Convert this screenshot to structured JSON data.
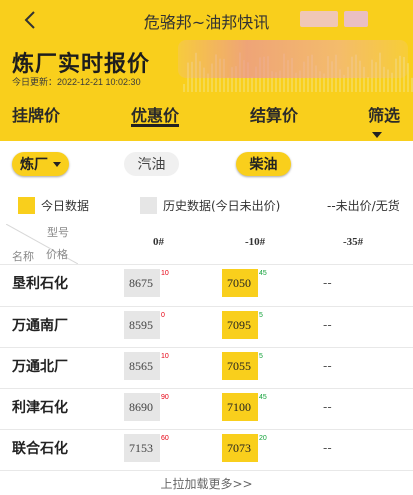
{
  "nav": {
    "title": "危骆邦~油邦快讯"
  },
  "header": {
    "title": "炼厂实时报价",
    "update_time": "今日更新：2022-12-21 10:02:30"
  },
  "tabs": [
    {
      "label": "挂牌价"
    },
    {
      "label": "优惠价",
      "active": true
    },
    {
      "label": "结算价"
    }
  ],
  "filter": {
    "label": "筛选"
  },
  "product_selector": {
    "refinery_dropdown": "炼厂",
    "options": [
      {
        "label": "汽油",
        "selected": false
      },
      {
        "label": "柴油",
        "selected": true
      }
    ]
  },
  "legend": {
    "today": "今日数据",
    "history": "历史数据(今日未出价)",
    "none": "--未出价/无货",
    "today_color": "#f9cf1c",
    "history_color": "#e6e6e6"
  },
  "table": {
    "corner_top": "型号",
    "corner_bottom_left": "名称",
    "corner_bottom_right": "价格",
    "columns": [
      "0#",
      "-10#",
      "-35#"
    ],
    "rows": [
      {
        "name": "垦利石化",
        "c0": "8675",
        "c0_delta": "10",
        "c1": "7050",
        "c1_delta": "45",
        "c2": "--"
      },
      {
        "name": "万通南厂",
        "c0": "8595",
        "c0_delta": "0",
        "c1": "7095",
        "c1_delta": "5",
        "c2": "--"
      },
      {
        "name": "万通北厂",
        "c0": "8565",
        "c0_delta": "10",
        "c1": "7055",
        "c1_delta": "5",
        "c2": "--"
      },
      {
        "name": "利津石化",
        "c0": "8690",
        "c0_delta": "90",
        "c1": "7100",
        "c1_delta": "45",
        "c2": "--"
      },
      {
        "name": "联合石化",
        "c0": "7153",
        "c0_delta": "60",
        "c1": "7073",
        "c1_delta": "20",
        "c2": "--"
      }
    ]
  },
  "footer": {
    "load_more": "上拉加载更多>>"
  }
}
